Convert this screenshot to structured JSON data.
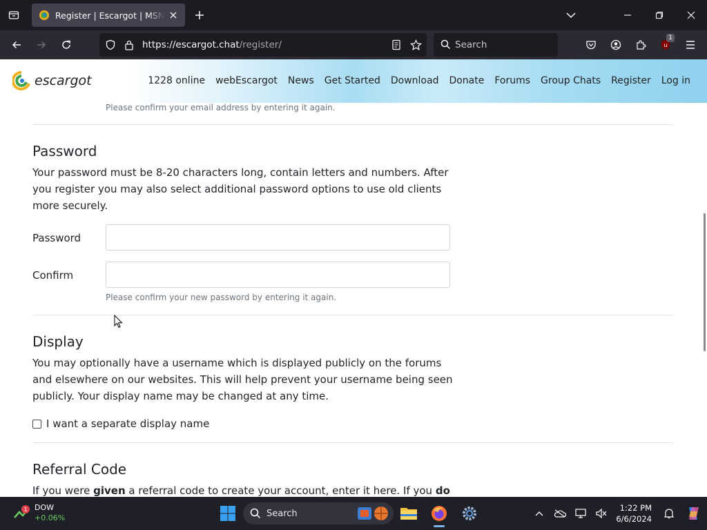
{
  "browser": {
    "tab_title": "Register | Escargot | MSN Messenger",
    "url_host": "https://escargot.chat",
    "url_path": "/register/",
    "search_placeholder": "Search",
    "extension_badge": "1"
  },
  "site": {
    "logo_text": "escargot",
    "nav": [
      "1228 online",
      "webEscargot",
      "News",
      "Get Started",
      "Download",
      "Donate",
      "Forums",
      "Group Chats",
      "Register",
      "Log in"
    ]
  },
  "form": {
    "email_confirm_hint": "Please confirm your email address by entering it again.",
    "password_section": {
      "title": "Password",
      "description": "Your password must be 8-20 characters long, contain letters and numbers. After you register you may also select additional password options to use old clients more securely.",
      "password_label": "Password",
      "password_value": "",
      "confirm_label": "Confirm",
      "confirm_value": "",
      "confirm_hint": "Please confirm your new password by entering it again."
    },
    "display_section": {
      "title": "Display",
      "description": "You may optionally have a username which is displayed publicly on the forums and elsewhere on our websites. This will help prevent your username being seen publicly. Your display name may be changed at any time.",
      "checkbox_label": "I want a separate display name",
      "checked": false
    },
    "referral_section": {
      "title": "Referral Code",
      "desc_part1": "If you were ",
      "desc_bold1": "given",
      "desc_part2": " a referral code to create your account, enter it here. If you ",
      "desc_bold2": "do not"
    }
  },
  "taskbar": {
    "stock_name": "DOW",
    "stock_change": "+0.06%",
    "stock_badge": "1",
    "search_label": "Search",
    "time": "1:22 PM",
    "date": "6/6/2024"
  },
  "colors": {
    "tab_bg": "#42414d",
    "titlebar_bg": "#1c1b22",
    "toolbar_bg": "#2b2a33",
    "taskbar_bg": "#1f1f27",
    "header_gradient_end": "#8fd1ee"
  }
}
